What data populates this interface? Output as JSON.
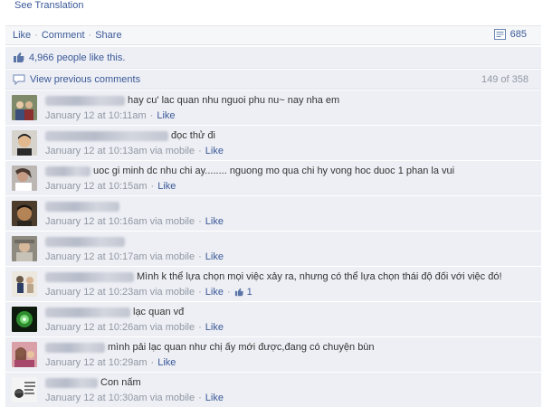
{
  "translation": {
    "label": "See Translation"
  },
  "actions": {
    "like": "Like",
    "comment": "Comment",
    "share": "Share",
    "share_count": "685"
  },
  "likes": {
    "text": "4,966 people like this."
  },
  "previous": {
    "label": "View previous comments",
    "count": "149 of 358"
  },
  "comments": [
    {
      "text": "hay cu' lac quan nhu nguoi phu nu~ nay nha em",
      "time": "January 12 at 10:11am",
      "via": "",
      "like": "Like",
      "likes": ""
    },
    {
      "text": "đọc thử đi",
      "time": "January 12 at 10:13am",
      "via": "via mobile",
      "like": "Like",
      "likes": ""
    },
    {
      "text": "uoc gi minh dc nhu chi ay........ nguong mo qua chi hy vong hoc duoc 1 phan la vui",
      "time": "January 12 at 10:15am",
      "via": "",
      "like": "Like",
      "likes": ""
    },
    {
      "text": "",
      "time": "January 12 at 10:16am",
      "via": "via mobile",
      "like": "Like",
      "likes": ""
    },
    {
      "text": "",
      "time": "January 12 at 10:17am",
      "via": "via mobile",
      "like": "Like",
      "likes": ""
    },
    {
      "text": "Mình k thể lựa chọn mọi việc xảy ra, nhưng có thể lựa chọn thái độ đối với việc đó!",
      "time": "January 12 at 10:23am",
      "via": "via mobile",
      "like": "Like",
      "likes": "1"
    },
    {
      "text": "lạc quan vđ",
      "time": "January 12 at 10:26am",
      "via": "via mobile",
      "like": "Like",
      "likes": ""
    },
    {
      "text": "mình pải lạc quan như chị ấy mới được,đang có chuyện bùn",
      "time": "January 12 at 10:29am",
      "via": "",
      "like": "Like",
      "likes": ""
    },
    {
      "text": "Con nấm",
      "time": "January 12 at 10:30am",
      "via": "via mobile",
      "like": "Like",
      "likes": ""
    }
  ],
  "colors": {
    "link": "#3b5998",
    "meta": "#9197a3",
    "panel": "#edeff4"
  }
}
